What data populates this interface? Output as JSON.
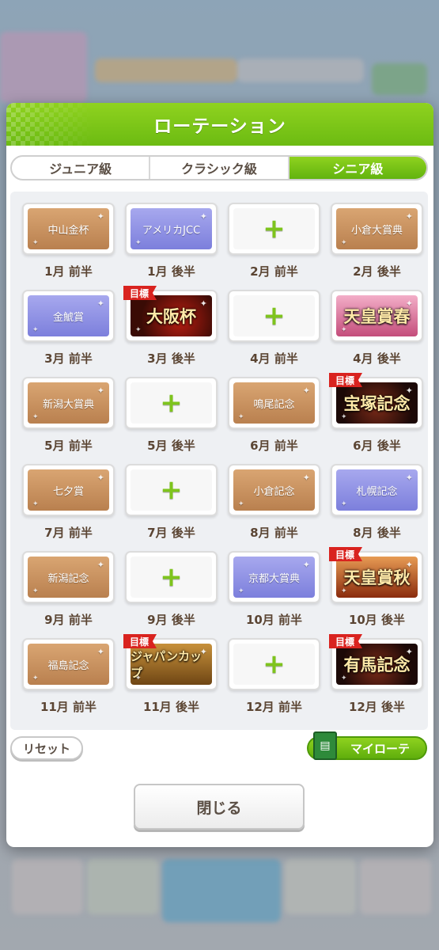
{
  "dialog": {
    "title": "ローテーション",
    "tabs": [
      {
        "label": "ジュニア級",
        "active": false
      },
      {
        "label": "クラシック級",
        "active": false
      },
      {
        "label": "シニア級",
        "active": true
      }
    ],
    "goal_badge": "目標",
    "slots": [
      {
        "race": "中山金杯",
        "style": "bronze",
        "goal": false,
        "period": "1月 前半"
      },
      {
        "race": "アメリカJCC",
        "style": "blue",
        "goal": false,
        "period": "1月 後半"
      },
      {
        "race": "",
        "style": "empty",
        "goal": false,
        "period": "2月 前半"
      },
      {
        "race": "小倉大賞典",
        "style": "bronze",
        "goal": false,
        "period": "2月 後半"
      },
      {
        "race": "金鯱賞",
        "style": "blue",
        "goal": false,
        "period": "3月 前半"
      },
      {
        "race": "大阪杯",
        "style": "g1-red",
        "goal": true,
        "period": "3月 後半"
      },
      {
        "race": "",
        "style": "empty",
        "goal": false,
        "period": "4月 前半"
      },
      {
        "race": "天皇賞春",
        "style": "g1-pink",
        "goal": false,
        "period": "4月 後半"
      },
      {
        "race": "新潟大賞典",
        "style": "bronze",
        "goal": false,
        "period": "5月 前半"
      },
      {
        "race": "",
        "style": "empty",
        "goal": false,
        "period": "5月 後半"
      },
      {
        "race": "鳴尾記念",
        "style": "bronze",
        "goal": false,
        "period": "6月 前半"
      },
      {
        "race": "宝塚記念",
        "style": "g1-dark",
        "goal": true,
        "period": "6月 後半"
      },
      {
        "race": "七夕賞",
        "style": "bronze",
        "goal": false,
        "period": "7月 前半"
      },
      {
        "race": "",
        "style": "empty",
        "goal": false,
        "period": "7月 後半"
      },
      {
        "race": "小倉記念",
        "style": "bronze",
        "goal": false,
        "period": "8月 前半"
      },
      {
        "race": "札幌記念",
        "style": "blue",
        "goal": false,
        "period": "8月 後半"
      },
      {
        "race": "新潟記念",
        "style": "bronze",
        "goal": false,
        "period": "9月 前半"
      },
      {
        "race": "",
        "style": "empty",
        "goal": false,
        "period": "9月 後半"
      },
      {
        "race": "京都大賞典",
        "style": "blue",
        "goal": false,
        "period": "10月 前半"
      },
      {
        "race": "天皇賞秋",
        "style": "g1-autumn",
        "goal": true,
        "period": "10月 後半"
      },
      {
        "race": "福島記念",
        "style": "bronze",
        "goal": false,
        "period": "11月 前半"
      },
      {
        "race": "ジャパンカップ",
        "style": "g1-gold",
        "goal": true,
        "period": "11月 後半"
      },
      {
        "race": "",
        "style": "empty",
        "goal": false,
        "period": "12月 前半"
      },
      {
        "race": "有馬記念",
        "style": "g1-dark",
        "goal": true,
        "period": "12月 後半"
      }
    ],
    "reset_label": "リセット",
    "my_rotation_label": "マイローテ",
    "close_label": "閉じる"
  },
  "colors": {
    "accent_green": "#7ec41d",
    "goal_red": "#d9231f",
    "label_brown": "#5b4533"
  },
  "icons": {
    "add": "plus-icon",
    "my_rotation": "notebook-icon",
    "sparkle": "sparkle-icon"
  }
}
